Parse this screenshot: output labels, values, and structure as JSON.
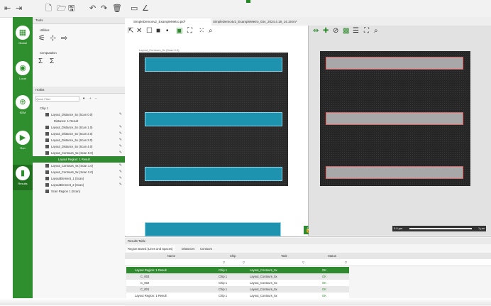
{
  "toolbar": {
    "icons": [
      "nav-back-icon",
      "nav-forward-icon",
      "new-file-icon",
      "open-folder-icon",
      "save-icon",
      "undo-icon",
      "redo-icon",
      "trash-icon",
      "rectangle-icon",
      "measure-icon"
    ]
  },
  "nav": {
    "items": [
      {
        "label": "Global",
        "icon": "grid-icon"
      },
      {
        "label": "Local",
        "icon": "local-icon"
      },
      {
        "label": "SEM",
        "icon": "sem-icon"
      },
      {
        "label": "Run",
        "icon": "play-icon"
      },
      {
        "label": "Results",
        "icon": "results-icon"
      }
    ]
  },
  "tools": {
    "title": "Tools",
    "utilities": "Utilities",
    "computation": "Computation"
  },
  "hotlist": {
    "title": "Hotlist",
    "filter_placeholder": "Quick Filter",
    "items": [
      {
        "label": "Chip 1"
      },
      {
        "label": "Layout_Distance_5x (Scan 0.0)"
      },
      {
        "label": "Distance: 1 Result"
      },
      {
        "label": "Layout_Distance_5x (Scan 1.0)"
      },
      {
        "label": "Layout_Distance_5x (Scan 2.0)"
      },
      {
        "label": "Layout_Distance_5x (Scan 3.0)"
      },
      {
        "label": "Layout_Distance_5x (Scan 4.0)"
      },
      {
        "label": "Layout_Contours_5x (Scan 0.0)"
      },
      {
        "label": "Layout Region: 1 Result"
      },
      {
        "label": "Layout_Contours_5x (Scan 1.0)"
      },
      {
        "label": "Layout_Contours_5x (Scan 2.0)"
      },
      {
        "label": "LayoutElement_1 (Scan)"
      },
      {
        "label": "LayoutElement_2 (Scan)"
      },
      {
        "label": "Scan Region 1 (Scan)"
      }
    ]
  },
  "tabs": [
    {
      "label": "SimpleDemo4v2_ExampleMetro.pid*"
    },
    {
      "label": "SimpleDemo4v2_ExampleMetro_034_2024.4.18_14.19.im*"
    }
  ],
  "view1": {
    "caption": "Layout_Contours_5x (Scan 0.0)"
  },
  "view2": {
    "scale_left": "0.0 µm",
    "scale_right": "1 µm"
  },
  "results": {
    "title": "Results Table",
    "tabs": [
      "Region Based (Lines and Spaces)",
      "Distances",
      "Contours"
    ],
    "columns": [
      "Name",
      "Chip",
      "Task",
      "Status"
    ],
    "rows": [
      {
        "name": "Layout Region: 1 Result",
        "chip": "Chip 1",
        "task": "Layout_Contours_5x",
        "status": "OK"
      },
      {
        "name": "C_003",
        "chip": "Chip 1",
        "task": "Layout_Contours_5x",
        "status": "OK"
      },
      {
        "name": "C_002",
        "chip": "Chip 1",
        "task": "Layout_Contours_5x",
        "status": "OK"
      },
      {
        "name": "C_001",
        "chip": "Chip 1",
        "task": "Layout_Contours_5x",
        "status": "OK"
      },
      {
        "name": "Layout Region: 1 Result",
        "chip": "Chip 1",
        "task": "Layout_Contours_5x",
        "status": "OK"
      }
    ]
  },
  "colors": {
    "accent": "#2f8f2f",
    "selected": "#2f8a2f",
    "blue": "#1d93b0"
  }
}
